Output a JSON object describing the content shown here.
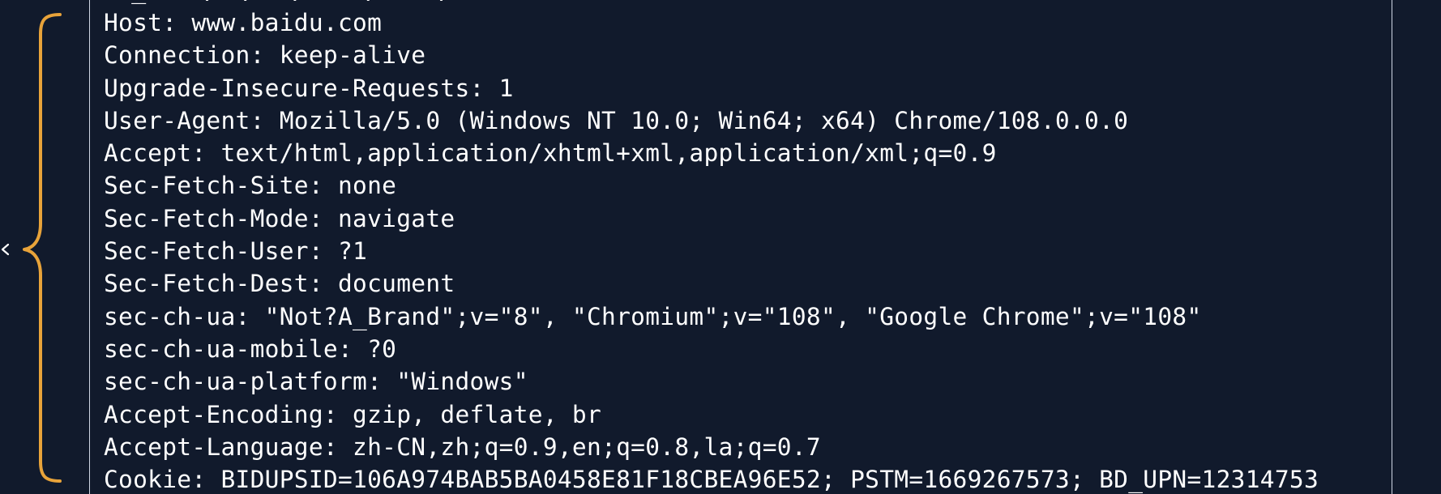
{
  "colors": {
    "background": "#111a2c",
    "text": "#ffffff",
    "brace": "#e8a33a",
    "panel_border": "#cfd6e4"
  },
  "icons": {
    "brace": "curly-brace-icon",
    "edge_mark": "arrow-left-icon"
  },
  "request_headers": [
    "Host: www.baidu.com",
    "Connection: keep-alive",
    "Upgrade-Insecure-Requests: 1",
    "User-Agent: Mozilla/5.0 (Windows NT 10.0; Win64; x64) Chrome/108.0.0.0",
    "Accept: text/html,application/xhtml+xml,application/xml;q=0.9",
    "Sec-Fetch-Site: none",
    "Sec-Fetch-Mode: navigate",
    "Sec-Fetch-User: ?1",
    "Sec-Fetch-Dest: document",
    "sec-ch-ua: \"Not?A_Brand\";v=\"8\", \"Chromium\";v=\"108\", \"Google Chrome\";v=\"108\"",
    "sec-ch-ua-mobile: ?0",
    "sec-ch-ua-platform: \"Windows\"",
    "Accept-Encoding: gzip, deflate, br",
    "Accept-Language: zh-CN,zh;q=0.9,en;q=0.8,la;q=0.7",
    "Cookie: BIDUPSID=106A974BAB5BA0458E81F18CBEA96E52; PSTM=1669267573; BD_UPN=12314753"
  ]
}
